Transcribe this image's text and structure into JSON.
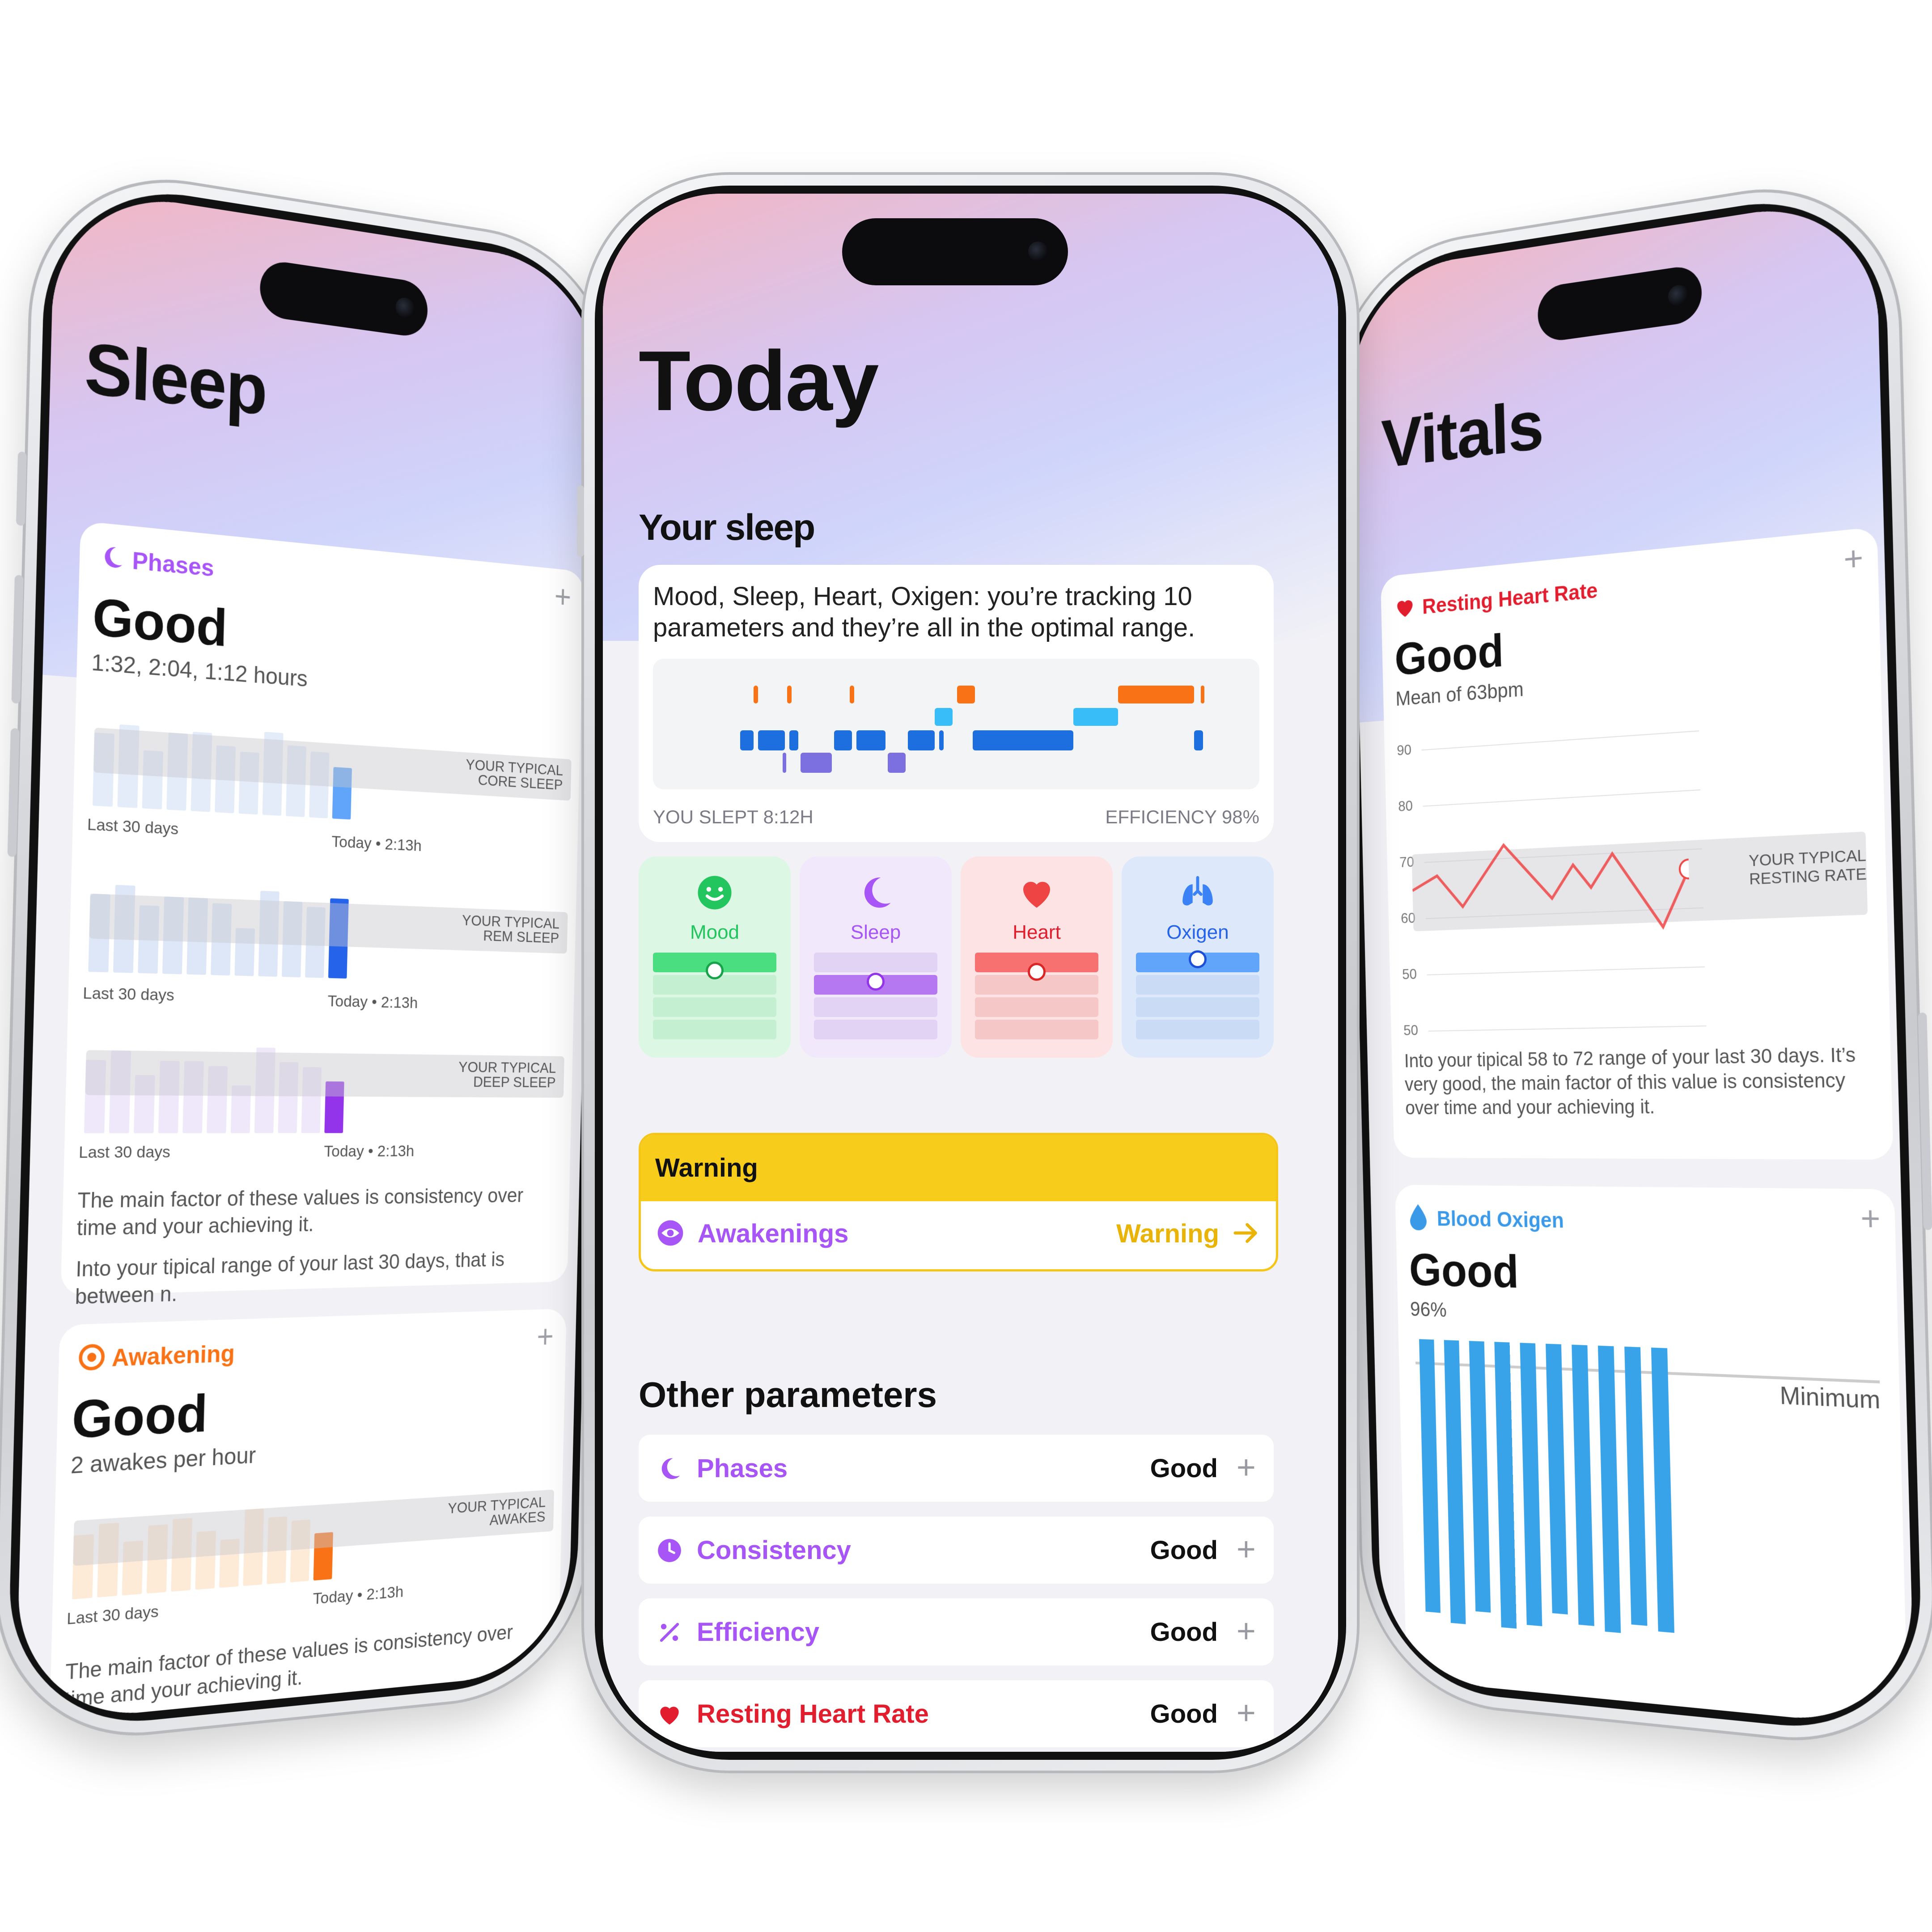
{
  "center": {
    "title": "Today",
    "section": "Your sleep",
    "summary": "Mood, Sleep, Heart, Oxigen: you’re tracking 10 parameters and they’re all in the optimal range.",
    "slept": "YOU SLEPT 8:12H",
    "efficiency": "EFFICIENCY 98%",
    "tiles": [
      {
        "label": "Mood",
        "icon": "smile-icon",
        "color": "#22c55e"
      },
      {
        "label": "Sleep",
        "icon": "moon-icon",
        "color": "#a855f7"
      },
      {
        "label": "Heart",
        "icon": "heart-icon",
        "color": "#ef4444"
      },
      {
        "label": "Oxigen",
        "icon": "lungs-icon",
        "color": "#3b82f6"
      }
    ],
    "warning": {
      "title": "Warning",
      "item": "Awakenings",
      "status": "Warning"
    },
    "other_title": "Other parameters",
    "params": [
      {
        "label": "Phases",
        "value": "Good",
        "icon": "moon-icon",
        "color": "#a855f7"
      },
      {
        "label": "Consistency",
        "value": "Good",
        "icon": "clock-icon",
        "color": "#a855f7"
      },
      {
        "label": "Efficiency",
        "value": "Good",
        "icon": "percent-icon",
        "color": "#a855f7"
      },
      {
        "label": "Resting Heart Rate",
        "value": "Good",
        "icon": "heart-icon",
        "color": "#e11d2e"
      }
    ]
  },
  "left": {
    "title": "Sleep",
    "phases": {
      "label": "Phases",
      "status": "Good",
      "detail": "1:32, 2:04, 1:12 hours",
      "charts": [
        {
          "band": [
            "YOUR TYPICAL",
            "CORE SLEEP"
          ],
          "left": "Last 30 days",
          "right": "Today • 2:13h",
          "color": "#60a5fa"
        },
        {
          "band": [
            "YOUR TYPICAL",
            "REM SLEEP"
          ],
          "left": "Last 30 days",
          "right": "Today • 2:13h",
          "color": "#2563eb"
        },
        {
          "band": [
            "YOUR TYPICAL",
            "DEEP SLEEP"
          ],
          "left": "Last 30 days",
          "right": "Today • 2:13h",
          "color": "#9333ea"
        }
      ],
      "para1": "The main factor of these values is consistency over time and your achieving it.",
      "para2": "Into your tipical range of your last 30 days, that is between n."
    },
    "awakening": {
      "label": "Awakening",
      "status": "Good",
      "detail": "2 awakes per hour",
      "band": [
        "YOUR TYPICAL",
        "AWAKES"
      ],
      "left": "Last 30 days",
      "right": "Today • 2:13h",
      "para": "The main factor of these values is consistency over time and your achieving it."
    }
  },
  "right": {
    "title": "Vitals",
    "heart": {
      "label": "Resting Heart Rate",
      "status": "Good",
      "detail": "Mean of 63bpm",
      "ticks": [
        "90",
        "80",
        "70",
        "60",
        "50",
        "50"
      ],
      "band": [
        "YOUR TYPICAL",
        "RESTING RATE"
      ],
      "para": "Into your tipical 58 to 72 range of your last 30 days. It’s very good, the main factor of this value is consistency over time and your achieving it."
    },
    "oxygen": {
      "label": "Blood Oxigen",
      "status": "Good",
      "detail": "96%",
      "minimum": "Minimum"
    }
  }
}
